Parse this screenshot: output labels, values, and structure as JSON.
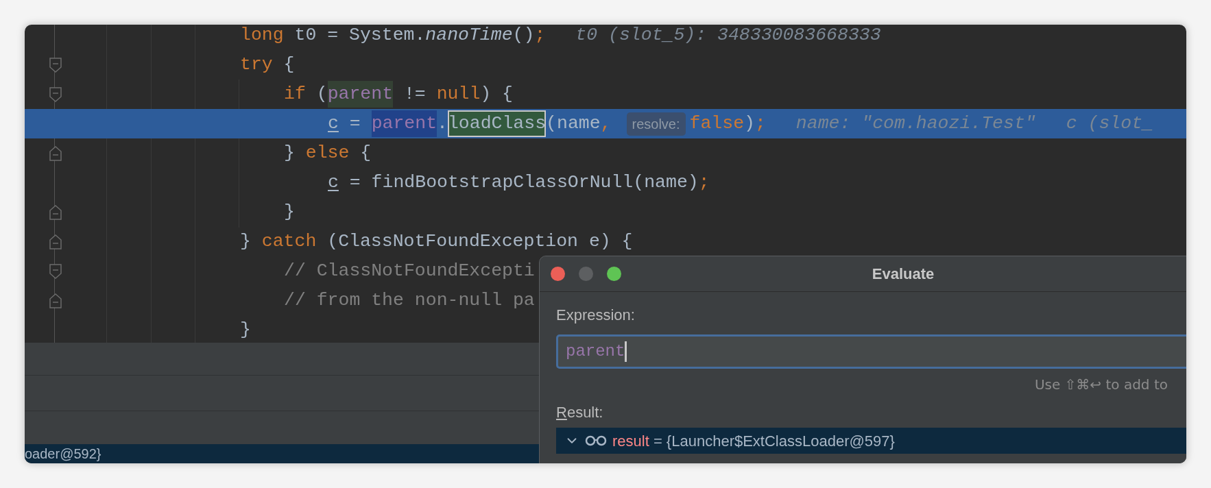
{
  "editor": {
    "lines": [
      {
        "selected": false,
        "tokens": [
          {
            "kind": "kw",
            "t": "long"
          },
          {
            "kind": "plain",
            "t": " t0 = System."
          },
          {
            "kind": "static",
            "t": "nanoTime"
          },
          {
            "kind": "plain",
            "t": "()"
          },
          {
            "kind": "kw",
            "t": ";"
          },
          {
            "kind": "hint",
            "t": "t0 (slot_5): 348330083668333"
          }
        ]
      },
      {
        "kind": "fold_open",
        "selected": false,
        "tokens": [
          {
            "kind": "kw",
            "t": "try"
          },
          {
            "kind": "plain",
            "t": " {"
          }
        ],
        "children": [
          {
            "kind": "fold_open",
            "selected": false,
            "tokens": [
              {
                "kind": "kw",
                "t": "if"
              },
              {
                "kind": "plain",
                "t": " ("
              },
              {
                "kind": "field_read",
                "t": "parent"
              },
              {
                "kind": "plain",
                "t": " != "
              },
              {
                "kind": "kw",
                "t": "null"
              },
              {
                "kind": "plain",
                "t": ") {"
              }
            ],
            "children": [
              {
                "selected": true,
                "tokens": [
                  {
                    "kind": "local",
                    "t": "c"
                  },
                  {
                    "kind": "plain",
                    "t": " = "
                  },
                  {
                    "kind": "field_write",
                    "t": "parent"
                  },
                  {
                    "kind": "plain",
                    "t": "."
                  },
                  {
                    "kind": "match",
                    "t": "loadClass"
                  },
                  {
                    "kind": "plain",
                    "t": "(name"
                  },
                  {
                    "kind": "kw",
                    "t": ","
                  },
                  {
                    "kind": "param",
                    "t": "resolve:"
                  },
                  {
                    "kind": "kw",
                    "t": "false"
                  },
                  {
                    "kind": "plain",
                    "t": ")"
                  },
                  {
                    "kind": "kw",
                    "t": ";"
                  },
                  {
                    "kind": "hint",
                    "t": "name: \"com.haozi.Test\""
                  },
                  {
                    "kind": "hint",
                    "t": "c (slot_"
                  }
                ]
              }
            ]
          },
          {
            "kind": "fold_close",
            "selected": false,
            "tokens": [
              {
                "kind": "plain",
                "t": "} "
              },
              {
                "kind": "kw",
                "t": "else"
              },
              {
                "kind": "plain",
                "t": " {"
              }
            ],
            "children": [
              {
                "selected": false,
                "tokens": [
                  {
                    "kind": "local",
                    "t": "c"
                  },
                  {
                    "kind": "plain",
                    "t": " = findBootstrapClassOrNull(name)"
                  },
                  {
                    "kind": "kw",
                    "t": ";"
                  }
                ]
              }
            ]
          },
          {
            "kind": "fold_close",
            "selected": false,
            "tokens": [
              {
                "kind": "plain",
                "t": "}"
              }
            ]
          }
        ]
      },
      {
        "kind": "fold_close",
        "selected": false,
        "tokens": [
          {
            "kind": "plain",
            "t": "} "
          },
          {
            "kind": "kw",
            "t": "catch"
          },
          {
            "kind": "plain",
            "t": " (ClassNotFoundException e) {"
          }
        ],
        "children": [
          {
            "kind": "fold_open",
            "selected": false,
            "tokens": [
              {
                "kind": "comment",
                "t": "// ClassNotFoundExcepti"
              }
            ]
          },
          {
            "kind": "fold_close",
            "selected": false,
            "tokens": [
              {
                "kind": "comment",
                "t": "// from the non-null pa"
              }
            ]
          }
        ]
      },
      {
        "selected": false,
        "tokens": [
          {
            "kind": "plain",
            "t": "}"
          }
        ]
      }
    ]
  },
  "bottom_row": {
    "text": "oader@592}",
    "selected": true
  },
  "dialog": {
    "title": "Evaluate",
    "expression_label": "Expression:",
    "expression": "parent",
    "shortcut_hint": "Use ⇧⌘↩ to add to",
    "result_label": "Result:",
    "results": [
      {
        "name": "result",
        "value": " = {Launcher$ExtClassLoader@597}",
        "expanded": true,
        "selected": true
      }
    ]
  }
}
